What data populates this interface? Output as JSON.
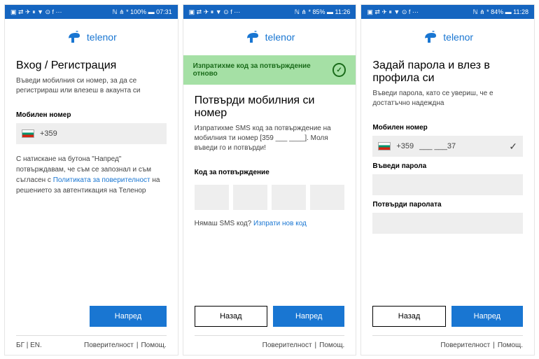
{
  "status": {
    "left": "▣ ⇄ ✈ ⏸ ▼ ⊙ f ⋯",
    "right1": "ℕ ⋔ * 100% ▬ 07:31",
    "right2": "ℕ ⋔ * 85% ▬ 11:26",
    "right3": "ℕ ⋔ * 84% ▬ 11:28"
  },
  "brand": "telenor",
  "screen1": {
    "title": "Bxog / Регистрация",
    "sub": "Въведи мобилния си номер, за да се регистрираш или влезеш в акаунта си",
    "numLabel": "Мобилен номер",
    "prefix": "+359",
    "consent1": "С натискане на бутона \"Напред\" потвърждавам, че съм се запознал и съм съгласен с ",
    "consentLink": "Политиката за поверителност",
    "consent2": " на решението за автентикация на Теленор",
    "next": "Напред",
    "lang": "БГ | EN.",
    "privacy": "Поверителност",
    "help": "Помощ."
  },
  "screen2": {
    "banner": "Изпратихме код за потвърждение отново",
    "title": "Потвърди мобилния си номер",
    "sub": "Изпратихме SMS код за потвърждение на мобилния ти номер [359 ___ ____]. Моля въведи го и потвърди!",
    "codeLabel": "Код за потвърждение",
    "resend1": "Нямаш SMS код? ",
    "resendLink": "Изпрати нов код",
    "back": "Назад",
    "next": "Напред",
    "privacy": "Поверителност",
    "help": "Помощ."
  },
  "screen3": {
    "title": "Задай парола и влез в профила си",
    "sub": "Въведи парола, като се увериш, че е достатъчно надеждна",
    "numLabel": "Мобилен номер",
    "prefix": "+359",
    "numValue": "___ ___37",
    "pwLabel": "Въведи парола",
    "pw2Label": "Потвърди паролата",
    "back": "Назад",
    "next": "Напред",
    "privacy": "Поверителност",
    "help": "Помощ."
  }
}
